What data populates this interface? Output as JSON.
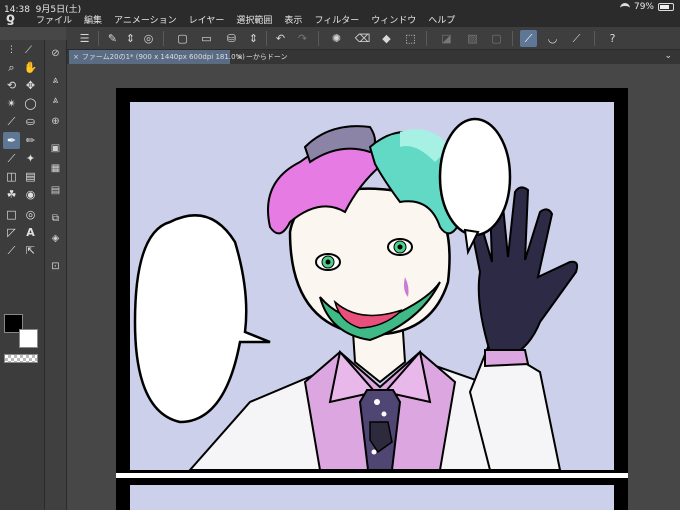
{
  "status": {
    "time": "14:38",
    "date": "9月5日(土)",
    "battery": "79%",
    "battery_fraction": 0.79
  },
  "menu": [
    "ファイル",
    "編集",
    "アニメーション",
    "レイヤー",
    "選択範囲",
    "表示",
    "フィルター",
    "ウィンドウ",
    "ヘルプ"
  ],
  "tabs": {
    "active": "ファーム20の1* (900 x 1440px 600dpi 181.0%)",
    "inactive": "ーからドーン"
  },
  "icons": {
    "logo": "clip-studio-logo",
    "menu": "hamburger-icon"
  },
  "colors": {
    "accent": "#5f7796",
    "foreground": "#000000",
    "background": "#ffffff",
    "panel_bg": "#ccd0ea"
  }
}
